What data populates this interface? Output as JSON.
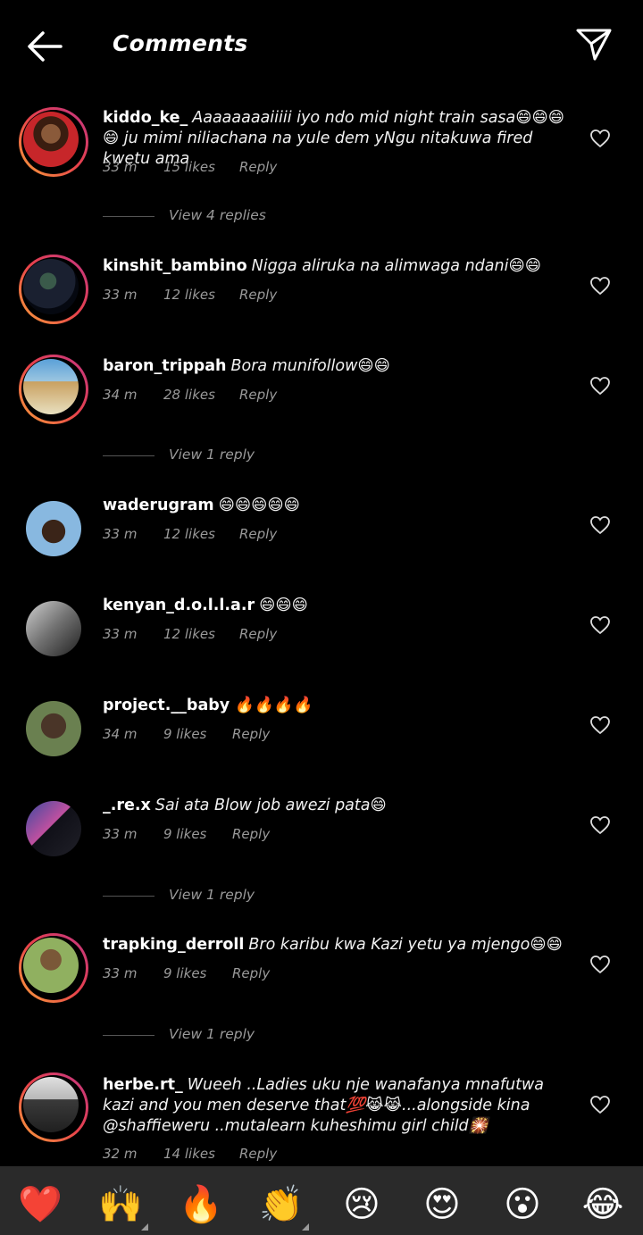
{
  "header": {
    "title": "Comments"
  },
  "comments": [
    {
      "username": "kiddo_ke_",
      "text": "Aaaaaaaaiiiii iyo ndo mid night train sasa😄😄😄😄 ju mimi niliachana na yule dem yNgu  nitakuwa fired kwetu ama",
      "time": "33 m",
      "likes": "15 likes",
      "reply": "Reply",
      "view_replies": "View 4 replies"
    },
    {
      "username": "kinshit_bambino",
      "text": "Nigga aliruka na alimwaga ndani😄😄",
      "time": "33 m",
      "likes": "12 likes",
      "reply": "Reply"
    },
    {
      "username": "baron_trippah",
      "text": "Bora munifollow😄😄",
      "time": "34 m",
      "likes": "28 likes",
      "reply": "Reply",
      "view_replies": "View 1 reply"
    },
    {
      "username": "waderugram",
      "text": "😄😄😄😄😄",
      "time": "33 m",
      "likes": "12 likes",
      "reply": "Reply"
    },
    {
      "username": "kenyan_d.o.l.l.a.r",
      "text": "😄😄😄",
      "time": "33 m",
      "likes": "12 likes",
      "reply": "Reply"
    },
    {
      "username": "project.__baby",
      "text": "🔥🔥🔥🔥",
      "time": "34 m",
      "likes": "9 likes",
      "reply": "Reply"
    },
    {
      "username": "_.re.x",
      "text": "Sai ata Blow job awezi pata😄",
      "time": "33 m",
      "likes": "9 likes",
      "reply": "Reply",
      "view_replies": "View 1 reply"
    },
    {
      "username": "trapking_derroll",
      "text": "Bro karibu kwa Kazi yetu ya mjengo😄😄",
      "time": "33 m",
      "likes": "9 likes",
      "reply": "Reply",
      "view_replies": "View 1 reply"
    },
    {
      "username": "herbe.rt_",
      "text": "Wueeh ..Ladies uku nje wanafanya mnafutwa kazi and you men deserve that💯😹😹...alongside kina @shaffieweru ..mutalearn kuheshimu girl child🎇",
      "time": "32 m",
      "likes": "14 likes",
      "reply": "Reply"
    }
  ],
  "emoji_bar": [
    "❤️",
    "🙌",
    "🔥",
    "👏",
    "😢",
    "😍",
    "😮",
    "😂"
  ],
  "colors": {
    "background": "#000000",
    "muted": "#9a9a9a",
    "bar": "#2a2a2a",
    "ring_start": "#f9a13a",
    "ring_end": "#c13584"
  }
}
